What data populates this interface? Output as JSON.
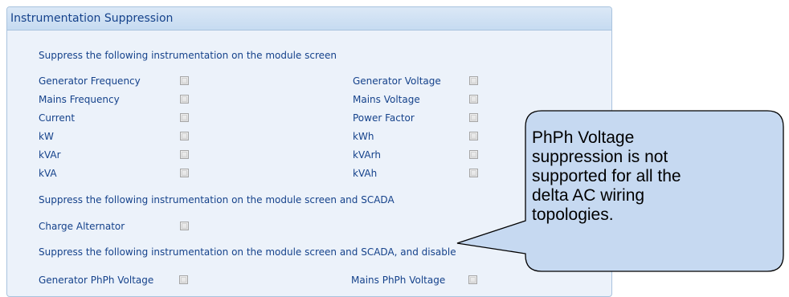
{
  "panel": {
    "title": "Instrumentation Suppression"
  },
  "section_module": {
    "heading": "Suppress the following instrumentation on the module screen",
    "left_items": [
      {
        "label": "Generator Frequency",
        "checked": false
      },
      {
        "label": "Mains Frequency",
        "checked": false
      },
      {
        "label": "Current",
        "checked": false
      },
      {
        "label": "kW",
        "checked": false
      },
      {
        "label": "kVAr",
        "checked": false
      },
      {
        "label": "kVA",
        "checked": false
      }
    ],
    "right_items": [
      {
        "label": "Generator Voltage",
        "checked": false
      },
      {
        "label": "Mains Voltage",
        "checked": false
      },
      {
        "label": "Power Factor",
        "checked": false
      },
      {
        "label": "kWh",
        "checked": false
      },
      {
        "label": "kVArh",
        "checked": false
      },
      {
        "label": "kVAh",
        "checked": false
      }
    ]
  },
  "section_scada": {
    "heading": "Suppress the following instrumentation on the module screen and SCADA",
    "items": [
      {
        "label": "Charge Alternator",
        "checked": false
      }
    ]
  },
  "section_disable": {
    "heading": "Suppress the following instrumentation on the module screen and SCADA, and disable",
    "items": [
      {
        "label": "Generator PhPh Voltage",
        "checked": false
      },
      {
        "label": "Mains PhPh Voltage",
        "checked": false
      }
    ]
  },
  "callout": {
    "lines": [
      "PhPh Voltage",
      "suppression is not",
      "supported for all the",
      "delta AC wiring",
      "topologies."
    ],
    "fill_color": "#c6d9f1",
    "stroke_color": "#000000"
  }
}
